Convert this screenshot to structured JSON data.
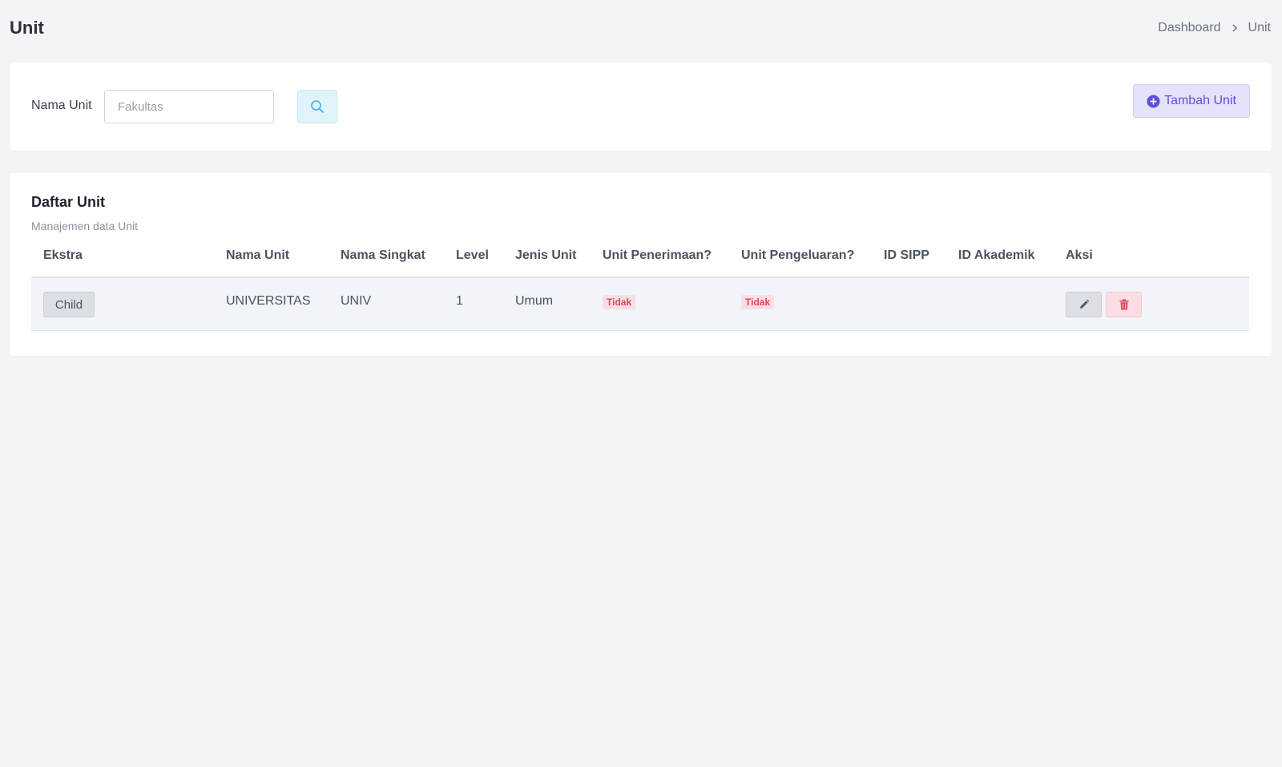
{
  "header": {
    "title": "Unit",
    "breadcrumb": [
      "Dashboard",
      "Unit"
    ]
  },
  "filter": {
    "label": "Nama Unit",
    "search_placeholder": "Fakultas",
    "search_value": "",
    "search_icon": "search-icon",
    "add_button_label": "Tambah Unit",
    "add_button_icon": "plus-circle-icon"
  },
  "list": {
    "title": "Daftar Unit",
    "subtitle": "Manajemen data Unit",
    "columns": [
      "Ekstra",
      "Nama Unit",
      "Nama Singkat",
      "Level",
      "Jenis Unit",
      "Unit Penerimaan?",
      "Unit Pengeluaran?",
      "ID SIPP",
      "ID Akademik",
      "Aksi"
    ],
    "rows": [
      {
        "ekstra": "Child",
        "nama_unit": "UNIVERSITAS",
        "nama_singkat": "UNIV",
        "level": "1",
        "jenis_unit": "Umum",
        "unit_penerimaan": "Tidak",
        "unit_pengeluaran": "Tidak",
        "id_sipp": "",
        "id_akademik": "",
        "actions": [
          "pencil-icon",
          "trash-icon"
        ]
      }
    ]
  },
  "colors": {
    "accent": "#5e50d8",
    "info_bg": "#e1f4fb",
    "danger": "#e0455f",
    "danger_bg": "#fbdde3",
    "secondary_bg": "#dcdfe3",
    "page_bg": "#f3f4f6"
  }
}
